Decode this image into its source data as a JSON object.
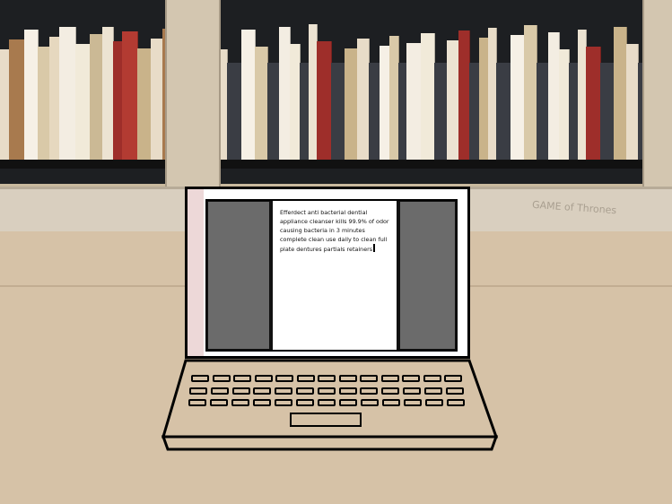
{
  "document": {
    "text": "Efferdect anti bacterial dential appliance cleanser kills 99.9% of odor causing bacteria in 3 minutes complete clean use daily to clean full plate dentures partials retainers"
  },
  "wall_scrawls": {
    "left": "",
    "right": "GAME of Thrones"
  },
  "colors": {
    "side_panels": "#6b6b6b",
    "document_bg": "#ffffff",
    "outline": "#000000"
  }
}
